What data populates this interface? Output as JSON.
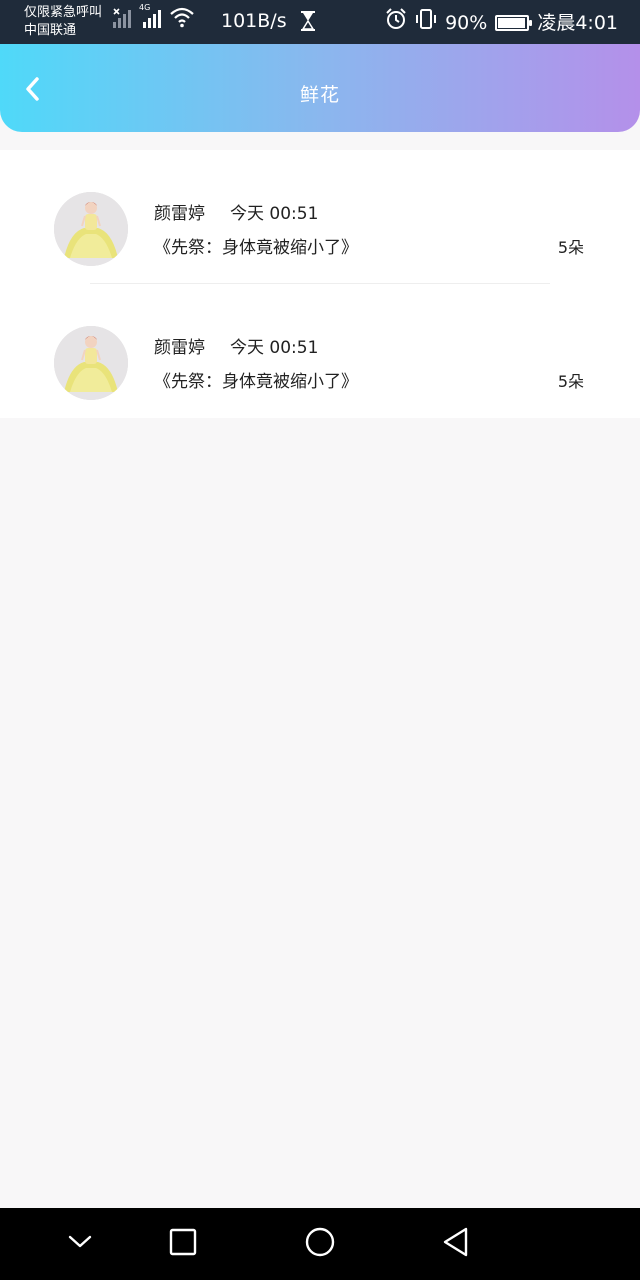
{
  "status_bar": {
    "carrier_line1": "仅限紧急呼叫",
    "carrier_line2": "中国联通",
    "network_type": "4G",
    "speed": "101B/s",
    "battery": "90%",
    "time": "凌晨4:01"
  },
  "header": {
    "title": "鲜花",
    "back_icon": "chevron-left-icon"
  },
  "list": {
    "items": [
      {
        "name": "颜雷婷",
        "time": "今天 00:51",
        "message": "《先祭：身体竟被缩小了》",
        "count": "5朵"
      },
      {
        "name": "颜雷婷",
        "time": "今天 00:51",
        "message": "《先祭：身体竟被缩小了》",
        "count": "5朵"
      }
    ]
  },
  "nav": {
    "icons": [
      "chevron-down-icon",
      "recent-apps-icon",
      "home-icon",
      "back-icon"
    ]
  },
  "colors": {
    "header_gradient_start": "#4fd9f9",
    "header_gradient_end": "#b490ea",
    "status_bar_bg": "#1f2b3a",
    "page_bg": "#f8f7f8"
  }
}
